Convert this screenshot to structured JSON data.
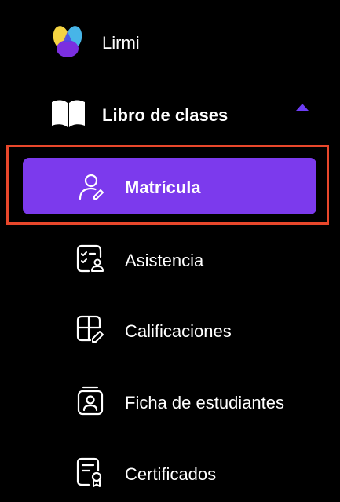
{
  "brand": {
    "name": "Lirmi"
  },
  "section": {
    "title": "Libro de clases",
    "expanded": true
  },
  "menu": {
    "items": [
      {
        "label": "Matrícula",
        "icon": "user-edit-icon",
        "active": true
      },
      {
        "label": "Asistencia",
        "icon": "attendance-icon",
        "active": false
      },
      {
        "label": "Calificaciones",
        "icon": "grades-icon",
        "active": false
      },
      {
        "label": "Ficha de estudiantes",
        "icon": "student-card-icon",
        "active": false
      },
      {
        "label": "Certificados",
        "icon": "certificate-icon",
        "active": false
      }
    ]
  },
  "colors": {
    "background": "#000000",
    "active": "#7c3aed",
    "highlight_border": "#e8472b",
    "text": "#ffffff",
    "caret": "#6d3df5"
  }
}
